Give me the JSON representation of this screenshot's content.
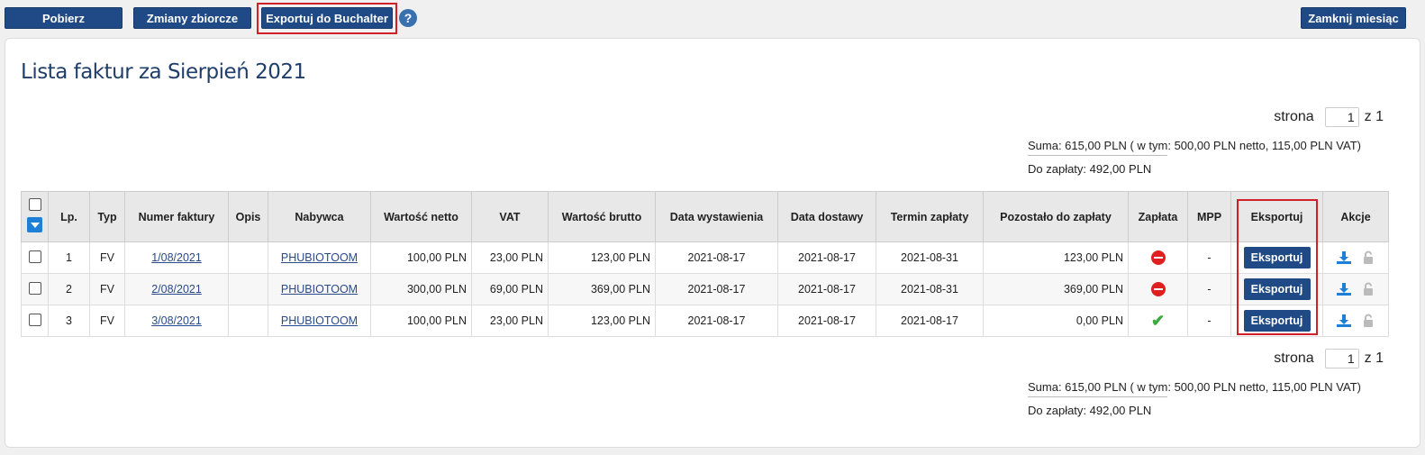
{
  "toolbar": {
    "fetch_label": "Pobierz",
    "bulk_changes_label": "Zmiany zbiorcze",
    "export_buchalter_label": "Exportuj do Buchalter",
    "help_label": "?",
    "close_month_label": "Zamknij miesiąc"
  },
  "page_title": "Lista faktur za Sierpień 2021",
  "pager_top": {
    "label": "strona",
    "current": "1",
    "of_label": "z 1"
  },
  "pager_bottom": {
    "label": "strona",
    "current": "1",
    "of_label": "z 1"
  },
  "summary_top": {
    "sum": "Suma:  615,00 PLN  ( w tym: 500,00 PLN netto, 115,00 PLN VAT)",
    "to_pay": "Do zapłaty:  492,00 PLN"
  },
  "summary_bottom": {
    "sum": "Suma:  615,00 PLN  ( w tym: 500,00 PLN netto, 115,00 PLN VAT)",
    "to_pay": "Do zapłaty:  492,00 PLN"
  },
  "table": {
    "headers": [
      "Lp.",
      "Typ",
      "Numer faktury",
      "Opis",
      "Nabywca",
      "Wartość netto",
      "VAT",
      "Wartość brutto",
      "Data wystawienia",
      "Data dostawy",
      "Termin zapłaty",
      "Pozostało do zapłaty",
      "Zapłata",
      "MPP",
      "Eksportuj",
      "Akcje"
    ],
    "export_button_label": "Eksportuj",
    "rows": [
      {
        "lp": "1",
        "typ": "FV",
        "numer": "1/08/2021",
        "opis": "",
        "nabywca": "PHUBIOTOOM",
        "netto": "100,00 PLN",
        "vat": "23,00 PLN",
        "brutto": "123,00 PLN",
        "data_wyst": "2021-08-17",
        "data_dost": "2021-08-17",
        "termin": "2021-08-31",
        "pozostalo": "123,00 PLN",
        "zaplata": "unpaid",
        "mpp": "-"
      },
      {
        "lp": "2",
        "typ": "FV",
        "numer": "2/08/2021",
        "opis": "",
        "nabywca": "PHUBIOTOOM",
        "netto": "300,00 PLN",
        "vat": "69,00 PLN",
        "brutto": "369,00 PLN",
        "data_wyst": "2021-08-17",
        "data_dost": "2021-08-17",
        "termin": "2021-08-31",
        "pozostalo": "369,00 PLN",
        "zaplata": "unpaid",
        "mpp": "-"
      },
      {
        "lp": "3",
        "typ": "FV",
        "numer": "3/08/2021",
        "opis": "",
        "nabywca": "PHUBIOTOOM",
        "netto": "100,00 PLN",
        "vat": "23,00 PLN",
        "brutto": "123,00 PLN",
        "data_wyst": "2021-08-17",
        "data_dost": "2021-08-17",
        "termin": "2021-08-17",
        "pozostalo": "0,00 PLN",
        "zaplata": "paid",
        "mpp": "-"
      }
    ]
  },
  "colors": {
    "primary": "#1f4a85",
    "highlight": "#d0202a",
    "unpaid": "#e02020",
    "paid": "#3aa83a"
  }
}
